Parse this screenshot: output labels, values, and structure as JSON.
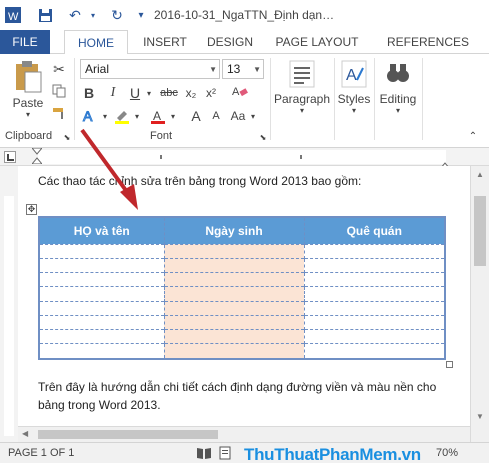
{
  "titlebar": {
    "doc_title": "2016-10-31_NgaTTN_Định dạn…",
    "undo_icon": "undo-icon",
    "redo_icon": "redo-icon"
  },
  "tabs": [
    {
      "label": "FILE"
    },
    {
      "label": "HOME"
    },
    {
      "label": "INSERT"
    },
    {
      "label": "DESIGN"
    },
    {
      "label": "PAGE LAYOUT"
    },
    {
      "label": "REFERENCES"
    }
  ],
  "ribbon": {
    "paste_label": "Paste",
    "clipboard_label": "Clipboard",
    "font_name": "Arial",
    "font_size": "13",
    "font_label": "Font",
    "bold": "B",
    "italic": "I",
    "underline": "U",
    "strike": "abc",
    "subscript": "x₂",
    "superscript": "x²",
    "paragraph_label": "Paragraph",
    "styles_label": "Styles",
    "editing_label": "Editing"
  },
  "document": {
    "intro": "Các thao tác chỉnh sửa trên bảng trong Word 2013 bao gồm:",
    "table_headers": [
      "HỌ và tên",
      "Ngày sinh",
      "Quê quán"
    ],
    "outro_line1": "Trên đây là hướng dẫn chi tiết cách định dạng đường viền và màu nền cho",
    "outro_line2": "bảng trong Word 2013."
  },
  "status": {
    "page": "PAGE 1 OF 1",
    "zoom": "70%"
  },
  "watermark": "ThuThuatPhanMem.vn",
  "colors": {
    "accent": "#2b579a",
    "table_header": "#5b9bd5",
    "table_highlight": "#fbe4d5",
    "arrow": "#c0282c"
  }
}
